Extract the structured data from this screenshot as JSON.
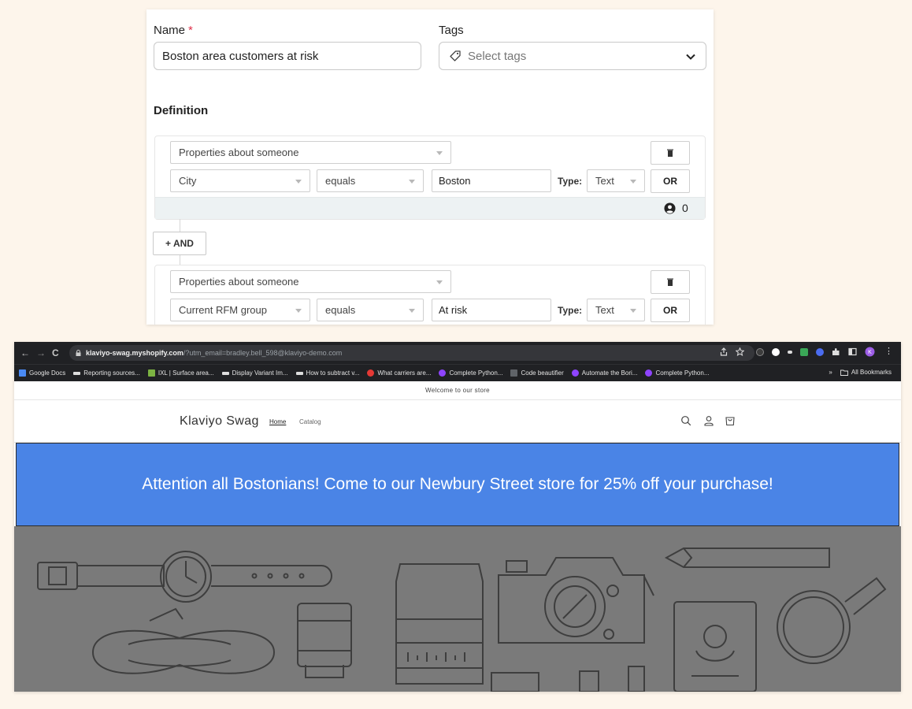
{
  "segment_form": {
    "name_label": "Name",
    "name_required_mark": "*",
    "name_value": "Boston area customers at risk",
    "tags_label": "Tags",
    "tags_placeholder": "Select tags",
    "definition_label": "Definition",
    "condition_groups": [
      {
        "type_select": "Properties about someone",
        "property": "City",
        "operator": "equals",
        "value": "Boston",
        "type_label": "Type:",
        "value_type": "Text",
        "or_label": "OR",
        "count": "0"
      },
      {
        "type_select": "Properties about someone",
        "property": "Current RFM group",
        "operator": "equals",
        "value": "At risk",
        "type_label": "Type:",
        "value_type": "Text",
        "or_label": "OR"
      }
    ],
    "and_button": "+ AND"
  },
  "browser": {
    "url_domain": "klaviyo-swag.myshopify.com",
    "url_path": "/?utm_email=bradley.bell_598@klaviyo-demo.com",
    "bookmarks": [
      {
        "label": "Google Docs",
        "color": "#4a8af4"
      },
      {
        "label": "Reporting sources...",
        "color": "#dddddd"
      },
      {
        "label": "IXL | Surface area...",
        "color": "#7cb342"
      },
      {
        "label": "Display Variant Im...",
        "color": "#dddddd"
      },
      {
        "label": "How to subtract v...",
        "color": "#dddddd"
      },
      {
        "label": "What carriers are...",
        "color": "#e53935"
      },
      {
        "label": "Complete Python...",
        "color": "#8e44ff"
      },
      {
        "label": "Code beautifier",
        "color": "#5f6368"
      },
      {
        "label": "Automate the Bori...",
        "color": "#8e44ff"
      },
      {
        "label": "Complete Python...",
        "color": "#8e44ff"
      }
    ],
    "bookmarks_overflow": "»",
    "all_bookmarks": "All Bookmarks"
  },
  "store": {
    "announcement": "Welcome to our store",
    "logo": "Klaviyo Swag",
    "nav": [
      "Home",
      "Catalog"
    ],
    "banner_text": "Attention all Bostonians! Come to our Newbury Street store for 25% off your purchase!"
  },
  "colors": {
    "banner_bg": "#4a84e6",
    "hero_bg": "#7a7a7a",
    "required": "#e0314b"
  }
}
